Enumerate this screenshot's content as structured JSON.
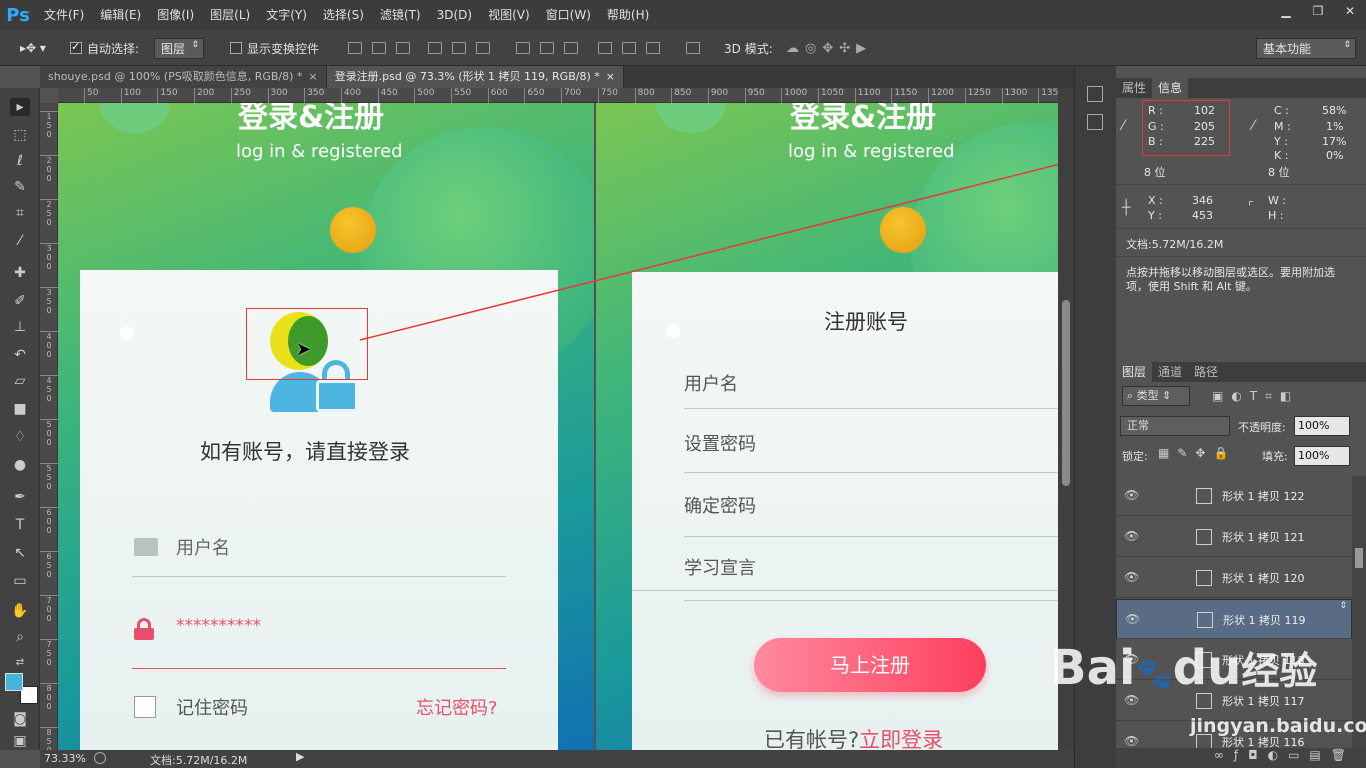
{
  "app": {
    "logo": "Ps",
    "menu": [
      "文件(F)",
      "编辑(E)",
      "图像(I)",
      "图层(L)",
      "文字(Y)",
      "选择(S)",
      "滤镜(T)",
      "3D(D)",
      "视图(V)",
      "窗口(W)",
      "帮助(H)"
    ],
    "window_buttons": [
      "▁",
      "❐",
      "✕"
    ]
  },
  "options": {
    "auto_select_label": "自动选择:",
    "auto_select_value": "图层",
    "show_transform_label": "显示变换控件",
    "mode_3d_label": "3D 模式:",
    "workspace": "基本功能"
  },
  "tabs": [
    {
      "label": "shouye.psd @ 100% (PS吸取颜色信息, RGB/8) *",
      "close": "×"
    },
    {
      "label": "登录注册.psd @ 73.3% (形状 1 拷贝 119, RGB/8) *",
      "close": "×"
    }
  ],
  "ruler_h": [
    "50",
    "100",
    "150",
    "200",
    "250",
    "300",
    "350",
    "400",
    "450",
    "500",
    "550",
    "600",
    "650",
    "700",
    "750",
    "800",
    "850",
    "900",
    "950",
    "1000",
    "1050",
    "1100",
    "1150",
    "1200",
    "1250",
    "1300",
    "135"
  ],
  "ruler_v": [
    "1 5 0",
    "2 0 0",
    "2 5 0",
    "3 0 0",
    "3 5 0",
    "4 0 0",
    "4 5 0",
    "5 0 0",
    "5 5 0",
    "6 0 0",
    "6 5 0",
    "7 0 0",
    "7 5 0",
    "8 0 0",
    "8 5 0"
  ],
  "login": {
    "title": "登录&注册",
    "subtitle": "log in & registered",
    "prompt": "如有账号，请直接登录",
    "username_placeholder": "用户名",
    "password_value": "**********",
    "remember": "记住密码",
    "forgot": "忘记密码?"
  },
  "register": {
    "title": "登录&注册",
    "subtitle": "log in & registered",
    "heading": "注册账号",
    "fields": [
      "用户名",
      "设置密码",
      "确定密码",
      "学习宣言"
    ],
    "button": "马上注册",
    "has_account": "已有帐号?",
    "login_link": "立即登录"
  },
  "status": {
    "zoom": "73.33%",
    "doc": "文档:5.72M/16.2M"
  },
  "info_panel": {
    "tabs": [
      "属性",
      "信息"
    ],
    "r_label": "R :",
    "r": "102",
    "g_label": "G :",
    "g": "205",
    "b_label": "B :",
    "b": "225",
    "c_label": "C :",
    "c": "58%",
    "m_label": "M :",
    "m": "1%",
    "y_label": "Y :",
    "y": "17%",
    "k_label": "K :",
    "k": "0%",
    "bits_left": "8 位",
    "bits_right": "8 位",
    "x_label": "X :",
    "x": "346",
    "yy_label": "Y :",
    "yy": "453",
    "w_label": "W :",
    "h_label": "H :",
    "doc": "文档:5.72M/16.2M",
    "hint": "点按并拖移以移动图层或选区。要用附加选项，使用 Shift 和 Alt 键。"
  },
  "layers_panel": {
    "tabs": [
      "图层",
      "通道",
      "路径"
    ],
    "kind": "类型",
    "blend": "正常",
    "opacity_label": "不透明度:",
    "opacity": "100%",
    "lock_label": "锁定:",
    "fill_label": "填充:",
    "fill": "100%",
    "layers": [
      "形状 1 拷贝 122",
      "形状 1 拷贝 121",
      "形状 1 拷贝 120",
      "形状 1 拷贝 119",
      "形状 1 拷贝 118",
      "形状 1 拷贝 117",
      "形状 1 拷贝 116"
    ],
    "selected_index": 3
  },
  "watermark": {
    "brand_left": "Bai",
    "brand_right": "du",
    "brand_cn": "经验",
    "url": "jingyan.baidu.com"
  },
  "colors": {
    "annotation_red": "#e53935",
    "accent_pink": "#e94f6b",
    "fg_swatch": "#46b4d9"
  }
}
